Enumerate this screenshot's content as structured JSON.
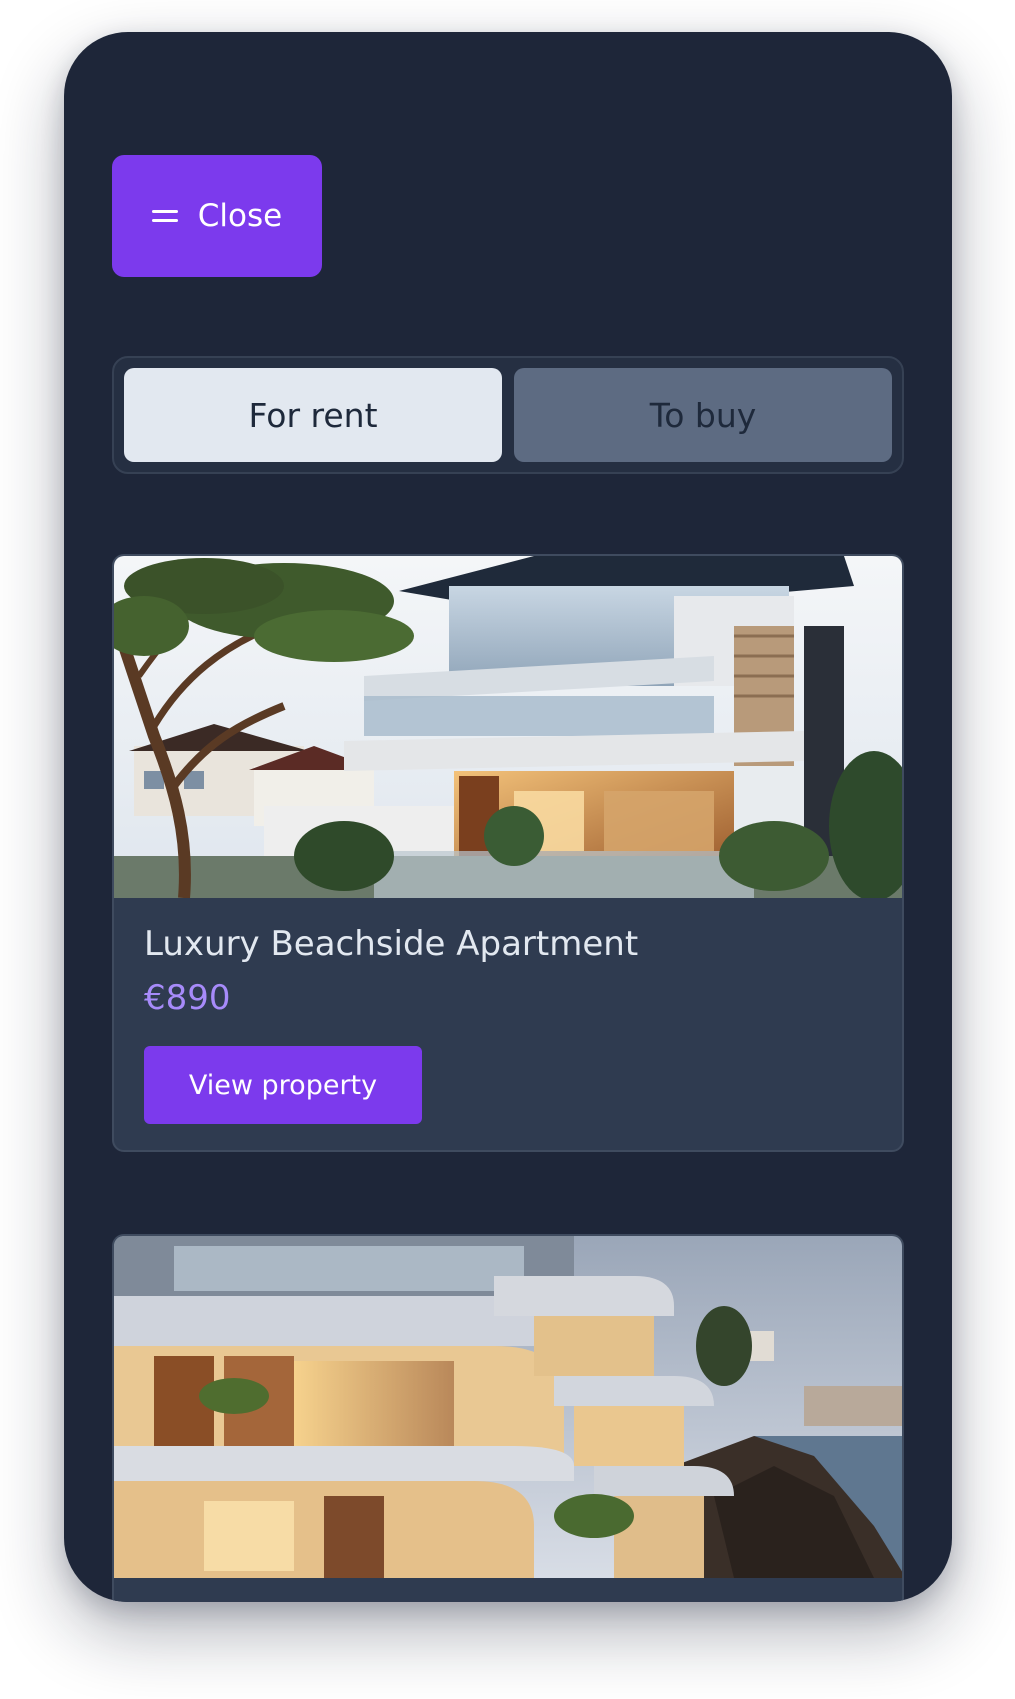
{
  "menu": {
    "close_label": "Close",
    "icon": "hamburger-icon"
  },
  "tabs": [
    {
      "label": "For rent",
      "active": true
    },
    {
      "label": "To buy",
      "active": false
    }
  ],
  "listings": [
    {
      "title": "Luxury Beachside Apartment",
      "price": "€890",
      "cta": "View property"
    }
  ],
  "colors": {
    "background": "#1e2639",
    "accent": "#7c3aed",
    "price": "#a78bfa",
    "card": "#2f3b50",
    "tab_active": "#e2e8f0",
    "tab_inactive": "#5d6b82"
  }
}
